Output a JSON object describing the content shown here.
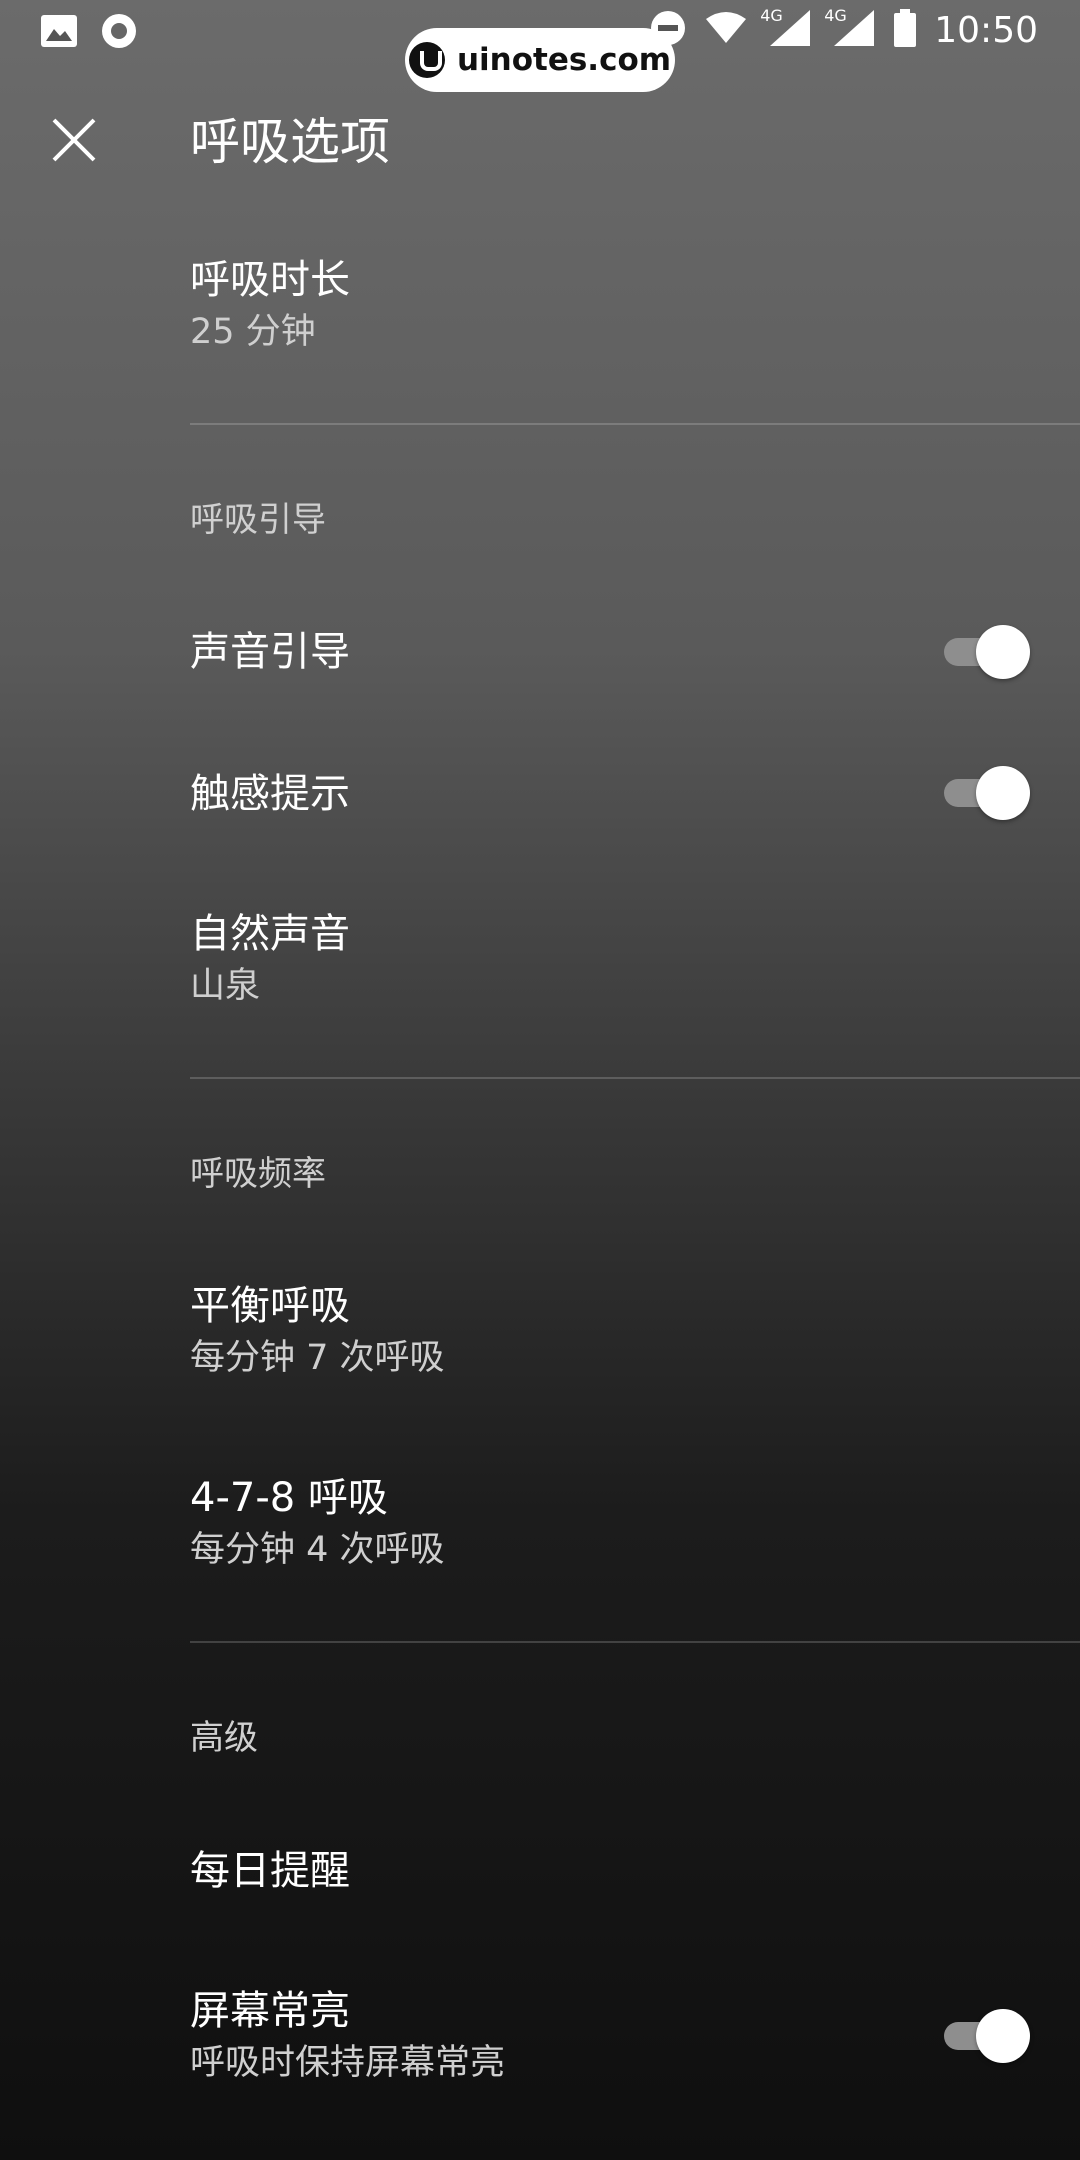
{
  "status_bar": {
    "time": "10:50",
    "network_1": "4G",
    "network_2": "4G",
    "watermark": "uinotes.com"
  },
  "header": {
    "title": "呼吸选项"
  },
  "duration": {
    "title": "呼吸时长",
    "value": "25 分钟"
  },
  "guidance": {
    "header": "呼吸引导",
    "sound_guidance": {
      "title": "声音引导",
      "enabled": true
    },
    "haptic": {
      "title": "触感提示",
      "enabled": true
    },
    "nature_sound": {
      "title": "自然声音",
      "value": "山泉"
    }
  },
  "rate": {
    "header": "呼吸频率",
    "balanced": {
      "title": "平衡呼吸",
      "value": "每分钟 7 次呼吸"
    },
    "478": {
      "title": "4-7-8 呼吸",
      "value": "每分钟 4 次呼吸"
    }
  },
  "advanced": {
    "header": "高级",
    "daily_reminder": {
      "title": "每日提醒"
    },
    "screen_on": {
      "title": "屏幕常亮",
      "value": "呼吸时保持屏幕常亮",
      "enabled": true
    }
  }
}
